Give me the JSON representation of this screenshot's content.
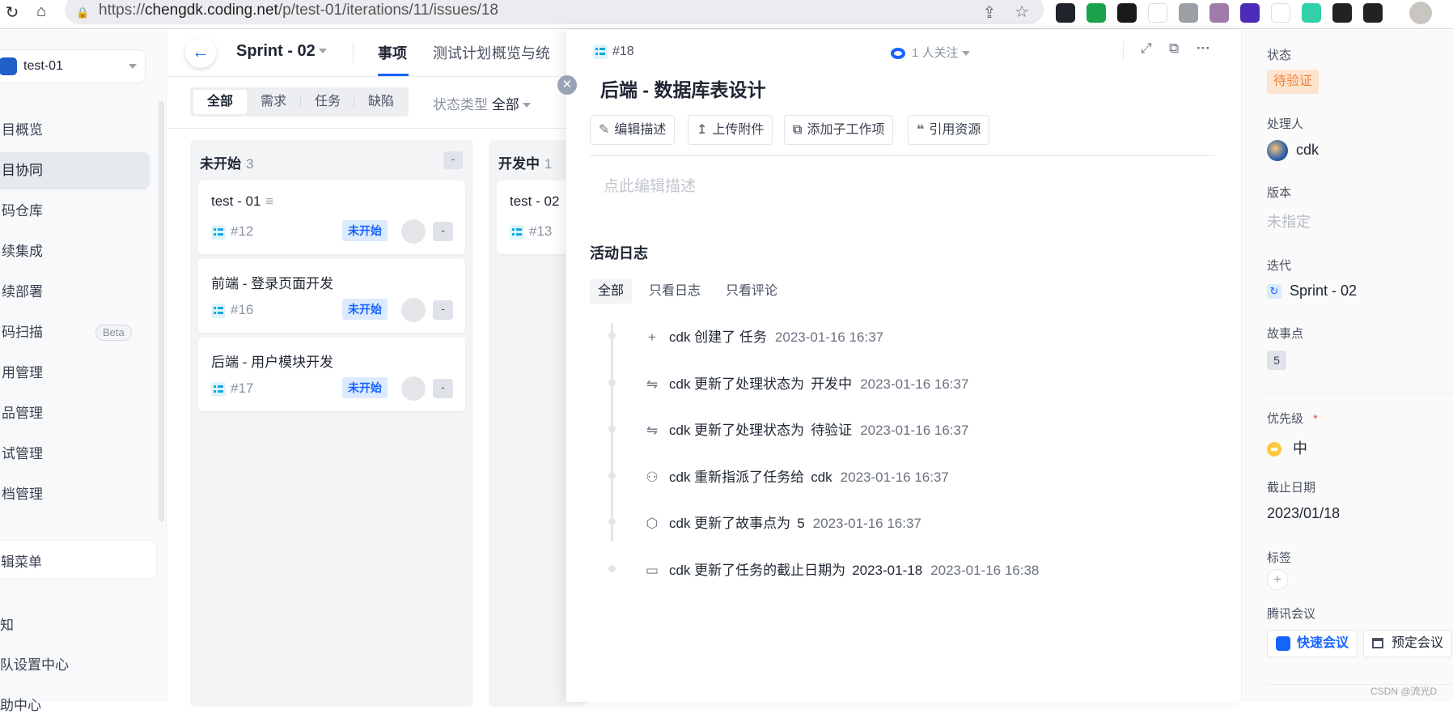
{
  "browser": {
    "url_scheme": "https://",
    "url_host": "chengdk.coding.net",
    "url_path": "/p/test-01/iterations/11/issues/18",
    "extensions": [
      {
        "icon": "react-devtools-icon",
        "color": "#20232a"
      },
      {
        "icon": "tampermonkey-shield-icon",
        "color": "#1aa34a"
      },
      {
        "icon": "infinity-icon",
        "color": "#1a1a1a"
      },
      {
        "icon": "x-extension-icon",
        "color": "#ffffff"
      },
      {
        "icon": "vue-devtools-icon",
        "color": "#9aa0a6"
      },
      {
        "icon": "kangaroo-icon",
        "color": "#a07aa8"
      },
      {
        "icon": "layers-icon",
        "color": "#4b2bb8"
      },
      {
        "icon": "y-extension-icon",
        "color": "#ffffff"
      },
      {
        "icon": "target-icon",
        "color": "#31d0a8"
      },
      {
        "icon": "puzzle-icon",
        "color": "#222222"
      },
      {
        "icon": "sidepanel-icon",
        "color": "#222222"
      }
    ]
  },
  "sidebar": {
    "project": "test-01",
    "items": [
      {
        "label": "目概览"
      },
      {
        "label": "目协同",
        "active": true
      },
      {
        "label": "码仓库"
      },
      {
        "label": "续集成"
      },
      {
        "label": "续部署"
      },
      {
        "label": "码扫描",
        "badge": "Beta"
      },
      {
        "label": "用管理"
      },
      {
        "label": "品管理"
      },
      {
        "label": "试管理"
      },
      {
        "label": "档管理"
      }
    ],
    "edit_menu": "辑菜单",
    "bottom": [
      "知",
      "队设置中心",
      "助中心"
    ]
  },
  "header": {
    "sprint": "Sprint - 02",
    "tabs": [
      {
        "label": "事项",
        "active": true
      },
      {
        "label": "测试计划"
      },
      {
        "label": "概览与统"
      }
    ]
  },
  "filter": {
    "segments": [
      "全部",
      "需求",
      "任务",
      "缺陷"
    ],
    "active": "全部",
    "status_type_label": "状态类型",
    "status_type_value": "全部"
  },
  "columns": [
    {
      "title": "未开始",
      "count": "3",
      "btn": "-",
      "cards": [
        {
          "title": "test - 01",
          "id": "#12",
          "status": "未开始",
          "assignee": "-",
          "has_desc": true
        },
        {
          "title": "前端 - 登录页面开发",
          "id": "#16",
          "status": "未开始",
          "assignee": "-"
        },
        {
          "title": "后端 - 用户模块开发",
          "id": "#17",
          "status": "未开始",
          "assignee": "-"
        }
      ]
    },
    {
      "title": "开发中",
      "count": "1",
      "cards": [
        {
          "title": "test - 02",
          "id": "#13"
        }
      ]
    }
  ],
  "detail": {
    "id": "#18",
    "title": "后端 - 数据库表设计",
    "watchers": "1 人关注",
    "actions": [
      "编辑描述",
      "上传附件",
      "添加子工作项",
      "引用资源"
    ],
    "description_placeholder": "点此编辑描述",
    "activity_title": "活动日志",
    "activity_tabs": [
      "全部",
      "只看日志",
      "只看评论"
    ],
    "activity": [
      {
        "icon": "plus-icon",
        "text": "cdk 创建了 任务",
        "value": "",
        "time": "2023-01-16 16:37"
      },
      {
        "icon": "swap-icon",
        "text": "cdk 更新了处理状态为",
        "value": "开发中",
        "time": "2023-01-16 16:37"
      },
      {
        "icon": "swap-icon",
        "text": "cdk 更新了处理状态为",
        "value": "待验证",
        "time": "2023-01-16 16:37"
      },
      {
        "icon": "user-icon",
        "text": "cdk 重新指派了任务给",
        "value": "cdk",
        "time": "2023-01-16 16:37"
      },
      {
        "icon": "cube-icon",
        "text": "cdk 更新了故事点为",
        "value": "5",
        "time": "2023-01-16 16:37"
      },
      {
        "icon": "calendar-icon",
        "text": "cdk 更新了任务的截止日期为",
        "value": "2023-01-18",
        "time": "2023-01-16 16:38"
      }
    ]
  },
  "props": {
    "status_label": "状态",
    "status": "待验证",
    "assignee_label": "处理人",
    "assignee": "cdk",
    "version_label": "版本",
    "version": "未指定",
    "iteration_label": "迭代",
    "iteration": "Sprint - 02",
    "points_label": "故事点",
    "points": "5",
    "priority_label": "优先级",
    "required": "*",
    "priority": "中",
    "due_label": "截止日期",
    "due": "2023/01/18",
    "tags_label": "标签",
    "tags_add": "+",
    "meeting_label": "腾讯会议",
    "quick_meeting": "快速会议",
    "book_meeting": "预定会议"
  },
  "colors": {
    "accent": "#1664ff",
    "status_pending": "#f5813e",
    "priority_medium": "#fcc93f"
  },
  "watermark": "CSDN @流光D"
}
